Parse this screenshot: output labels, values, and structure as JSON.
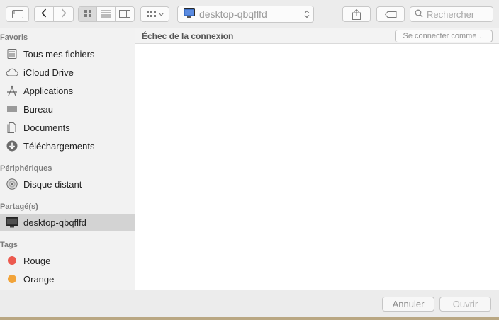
{
  "toolbar": {
    "path_label": "desktop-qbqflfd",
    "search_placeholder": "Rechercher"
  },
  "sidebar": {
    "sections": [
      {
        "title": "Favoris"
      },
      {
        "title": "Périphériques"
      },
      {
        "title": "Partagé(s)"
      },
      {
        "title": "Tags"
      }
    ],
    "favorites": [
      {
        "label": "Tous mes fichiers",
        "icon": "all-files-icon"
      },
      {
        "label": "iCloud Drive",
        "icon": "cloud-icon"
      },
      {
        "label": "Applications",
        "icon": "applications-icon"
      },
      {
        "label": "Bureau",
        "icon": "desktop-icon"
      },
      {
        "label": "Documents",
        "icon": "documents-icon"
      },
      {
        "label": "Téléchargements",
        "icon": "download-icon"
      }
    ],
    "devices": [
      {
        "label": "Disque distant",
        "icon": "disc-icon"
      }
    ],
    "shared": [
      {
        "label": "desktop-qbqflfd",
        "icon": "monitor-icon",
        "selected": true
      }
    ],
    "tags": [
      {
        "label": "Rouge",
        "color": "#ec5a4f"
      },
      {
        "label": "Orange",
        "color": "#f2a43a"
      }
    ]
  },
  "content": {
    "header_title": "Échec de la connexion",
    "connect_as_label": "Se connecter comme…"
  },
  "footer": {
    "cancel_label": "Annuler",
    "open_label": "Ouvrir"
  }
}
